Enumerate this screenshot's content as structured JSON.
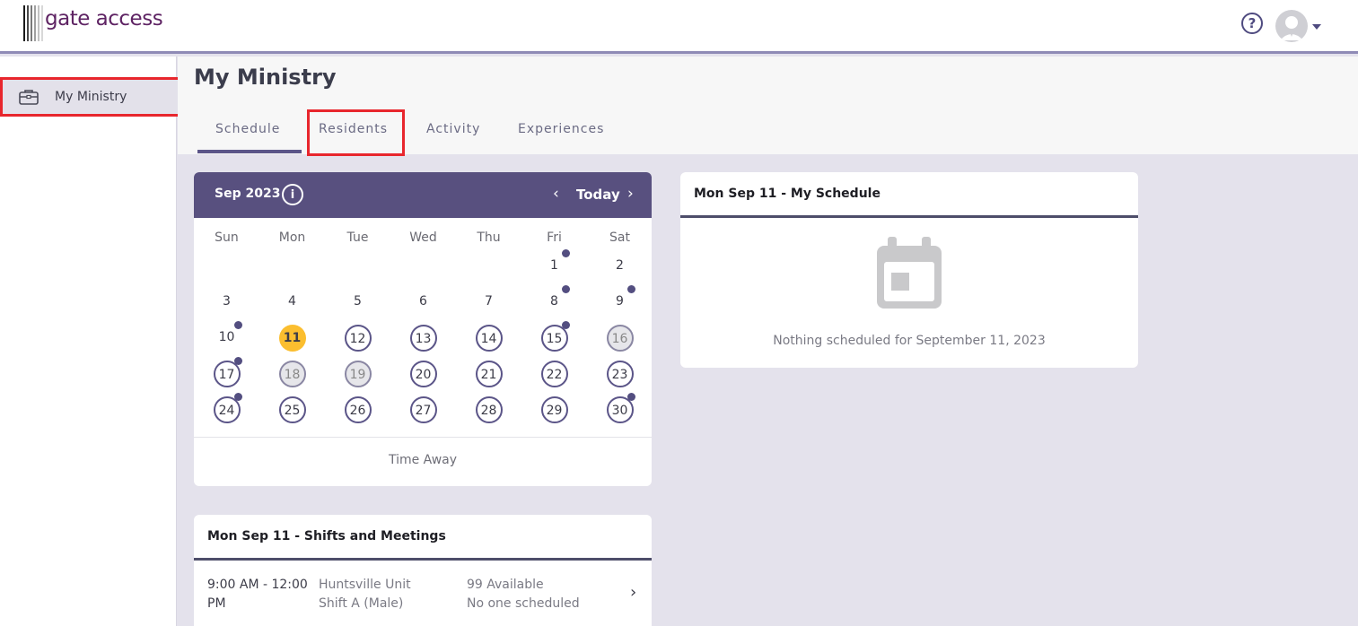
{
  "header": {
    "logo_text": "gate access",
    "help_glyph": "?",
    "icons": [
      "help-icon",
      "avatar-icon",
      "caret-down-icon"
    ]
  },
  "sidebar": {
    "items": [
      {
        "label": "My Ministry",
        "icon": "briefcase-icon"
      }
    ]
  },
  "page": {
    "title": "My Ministry",
    "tabs": [
      {
        "label": "Schedule",
        "active": true
      },
      {
        "label": "Residents"
      },
      {
        "label": "Activity"
      },
      {
        "label": "Experiences"
      }
    ]
  },
  "calendar": {
    "month_label": "Sep 2023",
    "info_glyph": "i",
    "prev_glyph": "‹",
    "today_label": "Today",
    "next_glyph": "›",
    "weekdays": [
      "Sun",
      "Mon",
      "Tue",
      "Wed",
      "Thu",
      "Fri",
      "Sat"
    ],
    "first_weekday_index": 5,
    "days_in_month": 30,
    "today_day": 11,
    "ringed_days": [
      12,
      13,
      14,
      15,
      17,
      20,
      21,
      22,
      23,
      24,
      25,
      26,
      27,
      28,
      29,
      30
    ],
    "greyed_days": [
      16,
      18,
      19
    ],
    "dot_days": [
      1,
      8,
      9,
      10,
      15,
      17,
      24,
      30
    ],
    "footer_label": "Time Away"
  },
  "my_schedule": {
    "title": "Mon Sep 11 - My Schedule",
    "icon": "calendar-icon",
    "empty_text": "Nothing scheduled for September 11, 2023"
  },
  "shifts": {
    "title": "Mon Sep 11 - Shifts and Meetings",
    "rows": [
      {
        "time_line1": "9:00 AM - 12:00",
        "time_line2": "PM",
        "location_line1": "Huntsville Unit",
        "location_line2": "Shift A (Male)",
        "availability_line1": "99 Available",
        "availability_line2": "No one scheduled",
        "chevron_glyph": "›"
      }
    ]
  },
  "colors": {
    "brand_purple": "#58507f",
    "logo_purple": "#5e2363",
    "today_yellow": "#fbbe2f",
    "highlight_red": "#e8262d",
    "page_bg": "#e4e2ec"
  }
}
